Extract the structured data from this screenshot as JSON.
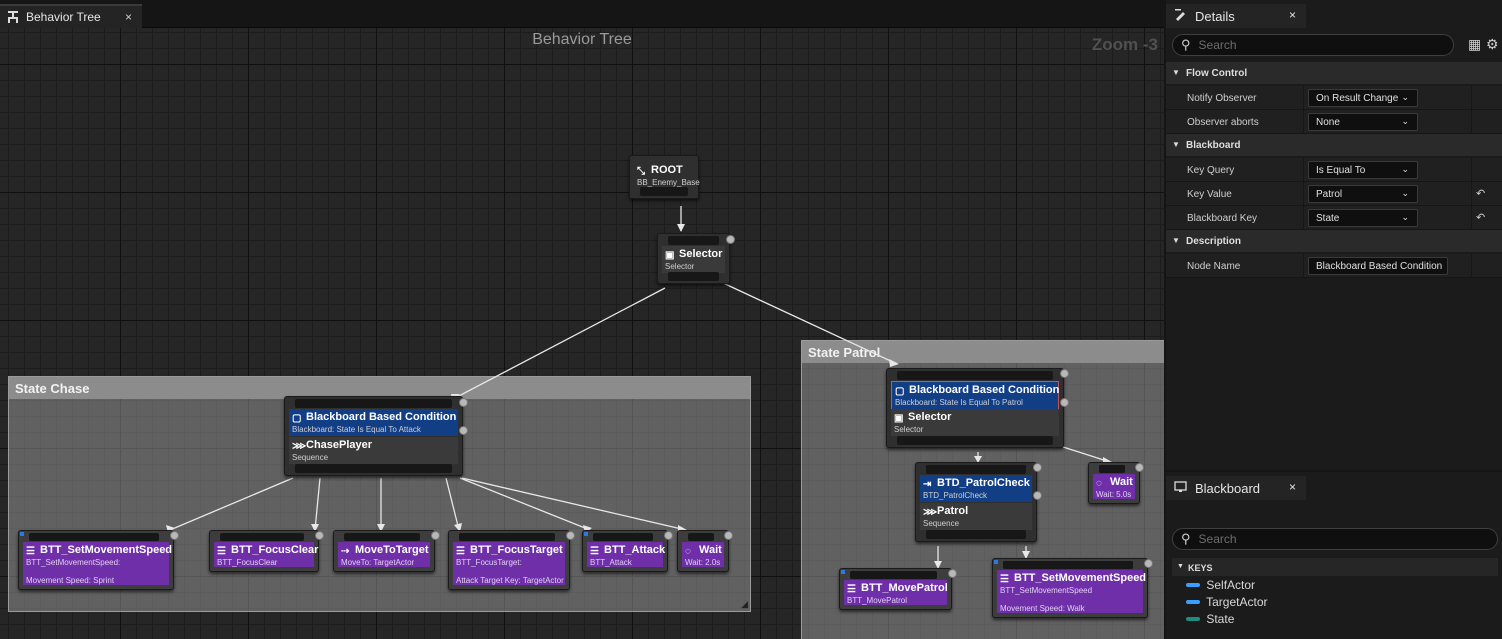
{
  "tab": {
    "title": "Behavior Tree",
    "close": "×"
  },
  "graph": {
    "title": "Behavior Tree",
    "zoom": "Zoom -3",
    "comments": {
      "chase": "State Chase",
      "patrol": "State Patrol"
    },
    "root": {
      "title": "ROOT",
      "sub": "BB_Enemy_Base"
    },
    "selector": {
      "title": "Selector",
      "sub": "Selector"
    },
    "chase": {
      "decorator": {
        "title": "Blackboard Based Condition",
        "sub": "Blackboard: State Is Equal To Attack"
      },
      "composite": {
        "title": "ChasePlayer",
        "sub": "Sequence"
      }
    },
    "patrol": {
      "decorator": {
        "title": "Blackboard Based Condition",
        "sub": "Blackboard: State Is Equal To Patrol"
      },
      "composite": {
        "title": "Selector",
        "sub": "Selector"
      },
      "check": {
        "title": "BTD_PatrolCheck",
        "sub": "BTD_PatrolCheck"
      },
      "sequence": {
        "title": "Patrol",
        "sub": "Sequence"
      },
      "wait": {
        "title": "Wait",
        "sub": "Wait: 5.0s"
      }
    },
    "tasks": [
      {
        "title": "BTT_SetMovementSpeed",
        "sub": "BTT_SetMovementSpeed:",
        "extra": "Movement Speed: Sprint"
      },
      {
        "title": "BTT_FocusClear",
        "sub": "BTT_FocusClear",
        "extra": ""
      },
      {
        "title": "MoveToTarget",
        "sub": "MoveTo: TargetActor",
        "extra": ""
      },
      {
        "title": "BTT_FocusTarget",
        "sub": "BTT_FocusTarget:",
        "extra": "Attack Target Key: TargetActor"
      },
      {
        "title": "BTT_Attack",
        "sub": "BTT_Attack",
        "extra": ""
      },
      {
        "title": "Wait",
        "sub": "Wait: 2.0s",
        "extra": ""
      },
      {
        "title": "BTT_MovePatrol",
        "sub": "BTT_MovePatrol",
        "extra": ""
      },
      {
        "title": "BTT_SetMovementSpeed",
        "sub": "BTT_SetMovementSpeed",
        "extra": "Movement Speed: Walk"
      }
    ]
  },
  "details": {
    "tab": "Details",
    "close": "×",
    "search_placeholder": "Search",
    "categories": {
      "flow": "Flow Control",
      "blackboard": "Blackboard",
      "description": "Description"
    },
    "rows": [
      {
        "label": "Notify Observer",
        "value": "On Result Change"
      },
      {
        "label": "Observer aborts",
        "value": "None"
      },
      {
        "label": "Key Query",
        "value": "Is Equal To"
      },
      {
        "label": "Key Value",
        "value": "Patrol"
      },
      {
        "label": "Blackboard Key",
        "value": "State"
      },
      {
        "label": "Node Name",
        "value": "Blackboard Based Condition"
      }
    ]
  },
  "blackboard": {
    "tab": "Blackboard",
    "close": "×",
    "search_placeholder": "Search",
    "keys_header": "KEYS",
    "keys": [
      {
        "name": "SelfActor",
        "color": "#3aa0ff"
      },
      {
        "name": "TargetActor",
        "color": "#3aa0ff"
      },
      {
        "name": "State",
        "color": "#1f8c7e"
      }
    ]
  },
  "colors": {
    "decorator": "#123e86",
    "task": "#6f2fa8",
    "accent": "#c25858"
  }
}
